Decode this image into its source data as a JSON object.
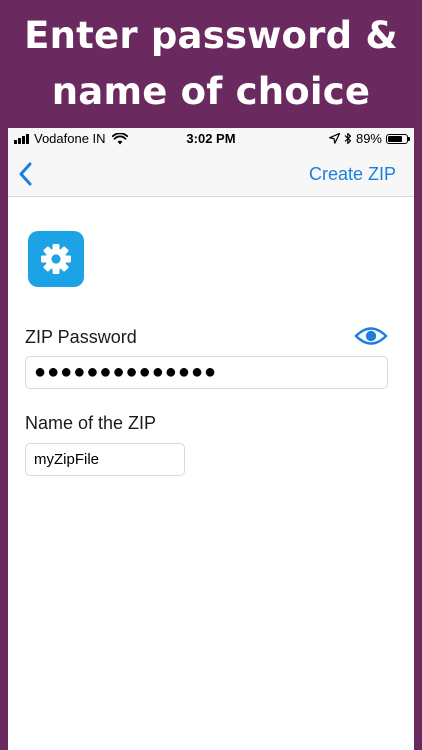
{
  "banner": {
    "line1": "Enter password &",
    "line2": "name of choice"
  },
  "status_bar": {
    "carrier": "Vodafone IN",
    "time": "3:02 PM",
    "battery_text": "89%",
    "battery_level": 0.89
  },
  "nav": {
    "back_icon": "chevron-left-icon",
    "create_label": "Create ZIP"
  },
  "app_icon": "gear-icon",
  "password": {
    "label": "ZIP Password",
    "value": "●●●●●●●●●●●●●●",
    "toggle_icon": "eye-icon"
  },
  "zip_name": {
    "label": "Name of the ZIP",
    "value": "myZipFile"
  },
  "colors": {
    "background": "#6b2a5f",
    "accent": "#1a7fe0",
    "app_icon_bg": "#1ba3e6"
  }
}
